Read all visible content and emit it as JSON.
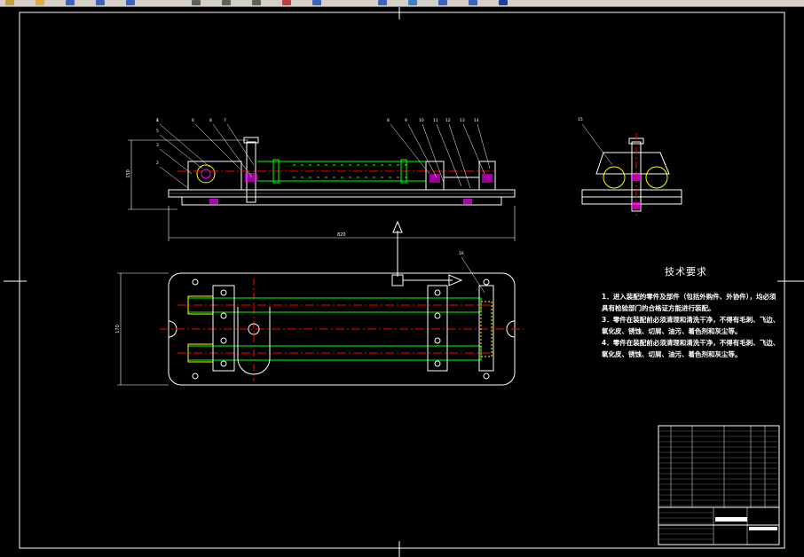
{
  "toolbar": {
    "buttons": [
      {
        "name": "new-icon",
        "color": "#c0a040"
      },
      {
        "name": "open-icon",
        "color": "#d8b040"
      },
      {
        "name": "save-icon",
        "color": "#4060c0"
      },
      {
        "name": "undo-icon",
        "color": "#4060c0"
      },
      {
        "name": "redo-icon",
        "color": "#4060c0"
      },
      {
        "name": "print-icon",
        "color": "#606060"
      },
      {
        "name": "cut-icon",
        "color": "#606060"
      },
      {
        "name": "copy-icon",
        "color": "#606060"
      },
      {
        "name": "paste-icon",
        "color": "#c04040"
      },
      {
        "name": "zoom-icon",
        "color": "#4060c0"
      },
      {
        "name": "pan-icon",
        "color": "#4060c0"
      },
      {
        "name": "layer-icon",
        "color": "#4080c0"
      },
      {
        "name": "properties-icon",
        "color": "#4060c0"
      },
      {
        "name": "block-icon",
        "color": "#4060c0"
      },
      {
        "name": "help-icon",
        "color": "#2040a0"
      }
    ]
  },
  "drawing": {
    "colors": {
      "outline": "#ffffff",
      "centerline": "#ff0000",
      "shaft": "#00ff00",
      "hatch": "#ffff00",
      "bolt": "#ff00ff",
      "leader": "#ffffff"
    },
    "dims": {
      "overall_length": "820",
      "height": "150",
      "width": "170"
    },
    "callouts_front": [
      "4",
      "5",
      "3",
      "2",
      "1",
      "6",
      "8",
      "7",
      "8",
      "9",
      "10",
      "11",
      "12",
      "13",
      "14"
    ],
    "callout_side": "15",
    "callout_top": "16"
  },
  "tech": {
    "title": "技术要求",
    "lines": [
      "1．进入装配的零件及部件（包括外购件、外协件），均必须",
      "具有检验部门的合格证方能进行装配。",
      "3．零件在装配前必须清理和清洗干净，不得有毛刺、飞边、",
      "氧化皮、锈蚀、切屑、油污、着色剂和灰尘等。",
      "4．零件在装配前必须清理和清洗干净，不得有毛刺、飞边、",
      "氧化皮、锈蚀、切屑、油污、着色剂和灰尘等。"
    ]
  }
}
